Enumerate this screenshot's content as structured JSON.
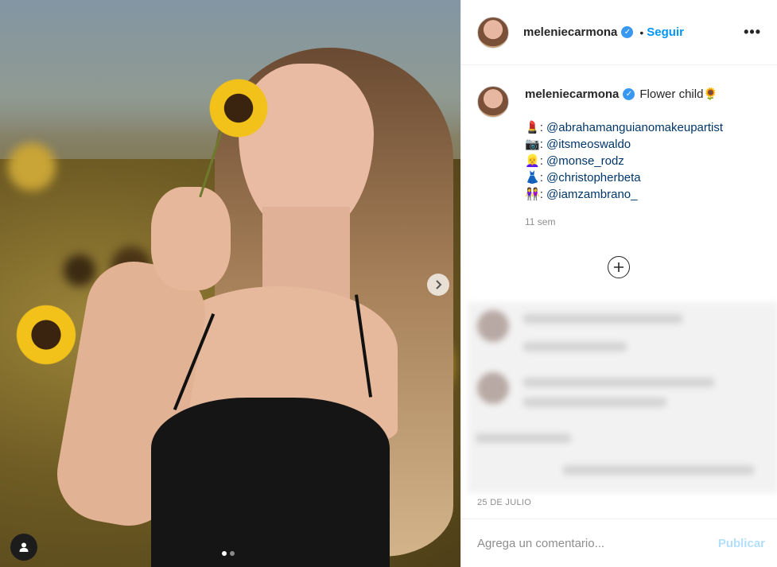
{
  "post": {
    "username": "meleniecarmona",
    "separator": "•",
    "follow_label": "Seguir",
    "more_icon": "•••",
    "caption_text": "Flower child🌻",
    "mentions": [
      {
        "emoji": "💄",
        "handle": "@abrahamanguianomakeupartist"
      },
      {
        "emoji": "📷",
        "handle": "@itsmeoswaldo"
      },
      {
        "emoji": "👱‍♀️",
        "handle": "@monse_rodz"
      },
      {
        "emoji": "👗",
        "handle": "@christopherbeta"
      },
      {
        "emoji": "👭",
        "handle": "@iamzambrano_"
      }
    ],
    "caption_time": "11 sem",
    "date": "25 DE JULIO"
  },
  "carousel": {
    "slide_count": 2,
    "active_slide": 1,
    "next_icon": "chevron-right-icon",
    "tag_icon": "user-tag-icon"
  },
  "comments": {
    "load_more_icon": "plus-circle-icon",
    "placeholder": "Agrega un comentario...",
    "publish_label": "Publicar"
  },
  "colors": {
    "link_blue": "#0095f6",
    "verified_blue": "#3897f0",
    "mention_dark_blue": "#00376b",
    "muted": "#8e8e8e",
    "publish_disabled": "#b2dffc"
  }
}
